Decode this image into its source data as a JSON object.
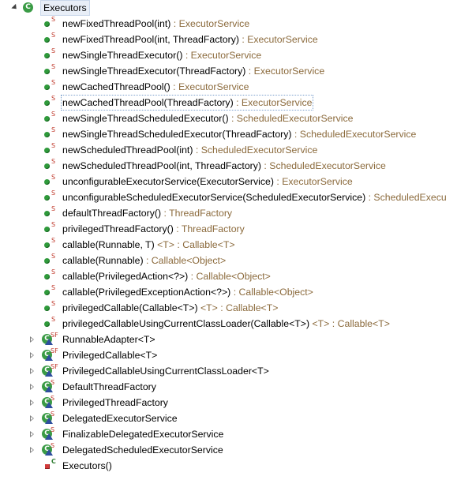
{
  "root": {
    "label": "Executors",
    "icon": "class-icon",
    "expanded": true
  },
  "methods": [
    {
      "name": "newFixedThreadPool(int)",
      "ret": "ExecutorService",
      "gen": ""
    },
    {
      "name": "newFixedThreadPool(int, ThreadFactory)",
      "ret": "ExecutorService",
      "gen": ""
    },
    {
      "name": "newSingleThreadExecutor()",
      "ret": "ExecutorService",
      "gen": ""
    },
    {
      "name": "newSingleThreadExecutor(ThreadFactory)",
      "ret": "ExecutorService",
      "gen": ""
    },
    {
      "name": "newCachedThreadPool()",
      "ret": "ExecutorService",
      "gen": ""
    },
    {
      "name": "newCachedThreadPool(ThreadFactory)",
      "ret": "ExecutorService",
      "gen": "",
      "selected": true
    },
    {
      "name": "newSingleThreadScheduledExecutor()",
      "ret": "ScheduledExecutorService",
      "gen": ""
    },
    {
      "name": "newSingleThreadScheduledExecutor(ThreadFactory)",
      "ret": "ScheduledExecutorService",
      "gen": ""
    },
    {
      "name": "newScheduledThreadPool(int)",
      "ret": "ScheduledExecutorService",
      "gen": ""
    },
    {
      "name": "newScheduledThreadPool(int, ThreadFactory)",
      "ret": "ScheduledExecutorService",
      "gen": ""
    },
    {
      "name": "unconfigurableExecutorService(ExecutorService)",
      "ret": "ExecutorService",
      "gen": ""
    },
    {
      "name": "unconfigurableScheduledExecutorService(ScheduledExecutorService)",
      "ret": "ScheduledExecu",
      "gen": ""
    },
    {
      "name": "defaultThreadFactory()",
      "ret": "ThreadFactory",
      "gen": ""
    },
    {
      "name": "privilegedThreadFactory()",
      "ret": "ThreadFactory",
      "gen": ""
    },
    {
      "name": "callable(Runnable, T)",
      "ret": "Callable<T>",
      "gen": "<T>"
    },
    {
      "name": "callable(Runnable)",
      "ret": "Callable<Object>",
      "gen": ""
    },
    {
      "name": "callable(PrivilegedAction<?>)",
      "ret": "Callable<Object>",
      "gen": ""
    },
    {
      "name": "callable(PrivilegedExceptionAction<?>)",
      "ret": "Callable<Object>",
      "gen": ""
    },
    {
      "name": "privilegedCallable(Callable<T>)",
      "ret": "Callable<T>",
      "gen": "<T>"
    },
    {
      "name": "privilegedCallableUsingCurrentClassLoader(Callable<T>)",
      "ret": "Callable<T>",
      "gen": "<T>"
    }
  ],
  "nested_classes": [
    {
      "name": "RunnableAdapter<T>",
      "mod": "SF",
      "expanded": false
    },
    {
      "name": "PrivilegedCallable<T>",
      "mod": "SF",
      "expanded": false
    },
    {
      "name": "PrivilegedCallableUsingCurrentClassLoader<T>",
      "mod": "SF",
      "expanded": false
    },
    {
      "name": "DefaultThreadFactory",
      "mod": "S",
      "expanded": false
    },
    {
      "name": "PrivilegedThreadFactory",
      "mod": "S",
      "expanded": false
    },
    {
      "name": "DelegatedExecutorService",
      "mod": "S",
      "expanded": false
    },
    {
      "name": "FinalizableDelegatedExecutorService",
      "mod": "S",
      "expanded": false
    },
    {
      "name": "DelegatedScheduledExecutorService",
      "mod": "S",
      "expanded": false
    }
  ],
  "constructor": {
    "name": "Executors()",
    "mod": "C"
  },
  "static_marker": "S",
  "separator": " : ",
  "colors": {
    "return_type": "#8b6a3c",
    "public_dot": "#2f9a3b",
    "private_square": "#d23a3a",
    "class_icon": "#3a9b45",
    "abstract_triangle": "#2f4f9e"
  }
}
